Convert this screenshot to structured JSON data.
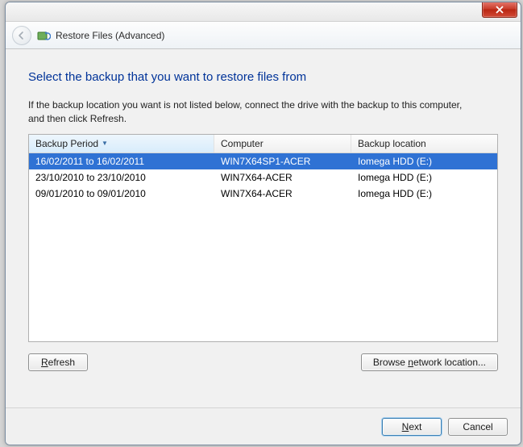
{
  "header": {
    "title": "Restore Files (Advanced)"
  },
  "main": {
    "heading": "Select the backup that you want to restore files from",
    "subtext": "If the backup location you want is not listed below, connect the drive with the backup to this computer, and then click Refresh.",
    "columns": {
      "period": "Backup Period",
      "computer": "Computer",
      "location": "Backup location"
    },
    "rows": [
      {
        "period": "16/02/2011 to 16/02/2011",
        "computer": "WIN7X64SP1-ACER",
        "location": "Iomega HDD (E:)",
        "selected": true
      },
      {
        "period": "23/10/2010 to 23/10/2010",
        "computer": "WIN7X64-ACER",
        "location": "Iomega HDD (E:)",
        "selected": false
      },
      {
        "period": "09/01/2010 to 09/01/2010",
        "computer": "WIN7X64-ACER",
        "location": "Iomega HDD (E:)",
        "selected": false
      }
    ],
    "buttons": {
      "refresh_pre": "R",
      "refresh_post": "efresh",
      "browse_pre": "Browse ",
      "browse_mid": "n",
      "browse_post": "etwork location..."
    }
  },
  "footer": {
    "next_pre": "",
    "next_mid": "N",
    "next_post": "ext",
    "cancel": "Cancel"
  }
}
